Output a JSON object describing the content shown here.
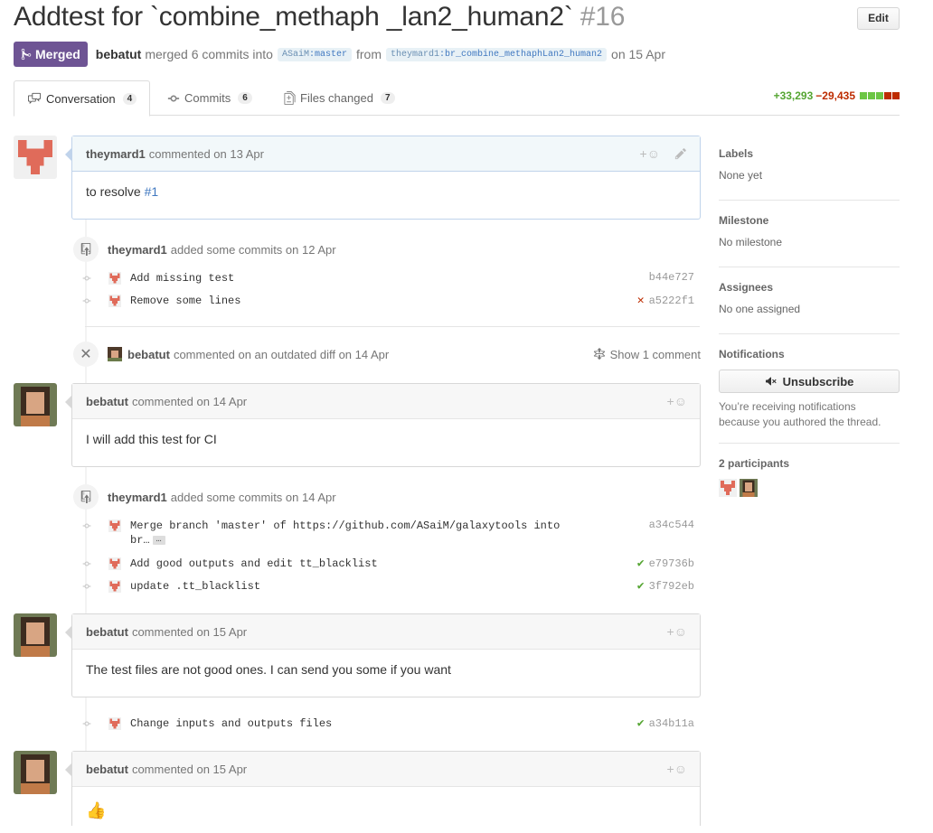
{
  "header": {
    "title": "Addtest for `combine_methaph _lan2_human2`",
    "number": "#16",
    "edit_label": "Edit"
  },
  "meta": {
    "state": "Merged",
    "author": "bebatut",
    "text_merged": "merged 6 commits into",
    "base_owner": "ASaiM",
    "base_branch": ":master",
    "text_from": "from",
    "head_owner": "theymard1",
    "head_branch": ":br_combine_methaphLan2_human2",
    "text_on": "on 15 Apr"
  },
  "tabs": [
    {
      "label": "Conversation",
      "count": "4",
      "icon": "comment-discussion-icon"
    },
    {
      "label": "Commits",
      "count": "6",
      "icon": "git-commit-icon"
    },
    {
      "label": "Files changed",
      "count": "7",
      "icon": "diff-icon"
    }
  ],
  "diffstat": {
    "additions": "+33,293",
    "deletions": "−29,435"
  },
  "timeline": {
    "c1": {
      "author": "theymard1",
      "meta": "commented on 13 Apr",
      "body_text": "to resolve ",
      "body_link": "#1"
    },
    "e1": {
      "author": "theymard1",
      "text": "added some commits on 12 Apr"
    },
    "commits1": [
      {
        "msg": "Add missing test",
        "sha": "b44e727",
        "status": ""
      },
      {
        "msg": "Remove some lines",
        "sha": "a5222f1",
        "status": "✕"
      }
    ],
    "e2": {
      "author": "bebatut",
      "text": "commented on an outdated diff on 14 Apr",
      "action": "Show 1 comment"
    },
    "c2": {
      "author": "bebatut",
      "meta": "commented on 14 Apr",
      "body": "I will add this test for CI"
    },
    "e3": {
      "author": "theymard1",
      "text": "added some commits on 14 Apr"
    },
    "commits2": [
      {
        "msg": "Merge branch 'master' of https://github.com/ASaiM/galaxytools into",
        "msg2": "br…",
        "sha": "a34c544",
        "status": ""
      },
      {
        "msg": "Add good outputs and edit tt_blacklist",
        "sha": "e79736b",
        "status": "✔"
      },
      {
        "msg": "update .tt_blacklist",
        "sha": "3f792eb",
        "status": "✔"
      }
    ],
    "c3": {
      "author": "bebatut",
      "meta": "commented on 15 Apr",
      "body": "The test files are not good ones. I can send you some if you want"
    },
    "commits3": [
      {
        "msg": "Change inputs and outputs files",
        "sha": "a34b11a",
        "status": "✔"
      }
    ],
    "c4": {
      "author": "bebatut",
      "meta": "commented on 15 Apr",
      "body": "👍"
    },
    "ellipsis": "…"
  },
  "sidebar": {
    "labels": {
      "title": "Labels",
      "value": "None yet"
    },
    "milestone": {
      "title": "Milestone",
      "value": "No milestone"
    },
    "assignees": {
      "title": "Assignees",
      "value": "No one assigned"
    },
    "notifications": {
      "title": "Notifications",
      "button": "Unsubscribe",
      "note": "You’re receiving notifications because you authored the thread."
    },
    "participants": {
      "title": "2 participants"
    }
  },
  "colors": {
    "merged": "#6e5494",
    "add": "#55a532",
    "del": "#bd2c00",
    "link": "#4078c0"
  }
}
